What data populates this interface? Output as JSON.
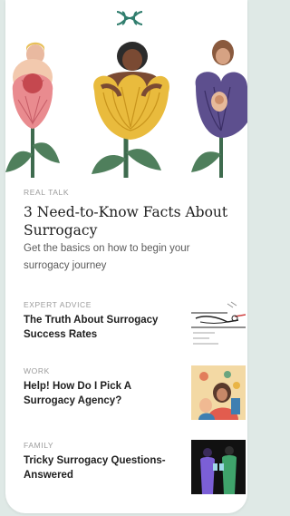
{
  "hero": {
    "kicker": "REAL TALK",
    "title": "3 Need-to-Know Facts About Surrogacy",
    "subtitle": "Get the basics on how to begin your surrogacy journey"
  },
  "articles": [
    {
      "kicker": "EXPERT ADVICE",
      "title": "The Truth About Surrogacy Success Rates",
      "thumb_icon": "stork-illustration"
    },
    {
      "kicker": "WORK",
      "title": "Help! How Do I Pick A Surrogacy Agency?",
      "thumb_icon": "family-illustration"
    },
    {
      "kicker": "FAMILY",
      "title": "Tricky Surrogacy Questions-Answered",
      "thumb_icon": "phone-users-illustration"
    }
  ],
  "colors": {
    "accent": "#2f7d6d",
    "text": "#1f1f1f",
    "muted": "#9b9b9b",
    "background": "#dfe9e6"
  }
}
